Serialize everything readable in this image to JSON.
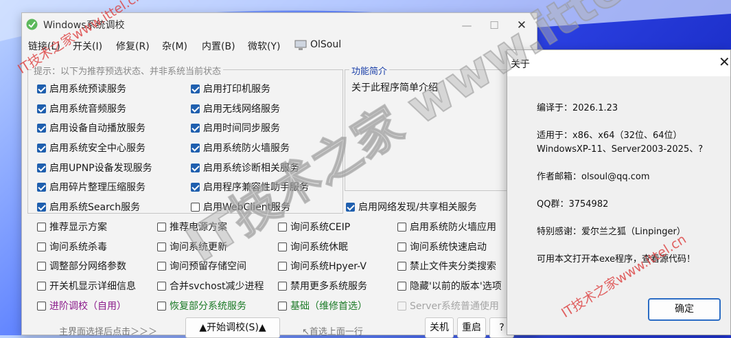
{
  "window": {
    "title": "Windows系统调校"
  },
  "menu": [
    "链接(L)",
    "开关(I)",
    "修复(R)",
    "杂(M)",
    "内置(B)",
    "微软(Y)",
    "OlSoul"
  ],
  "tips_group_label": "提示：以下为推荐预选状态、并非系统当前状态",
  "intro_group": {
    "label": "功能简介",
    "text": "关于此程序简单介绍"
  },
  "checkboxes": {
    "col1": [
      {
        "label": "启用系统预读服务",
        "checked": true
      },
      {
        "label": "启用系统音频服务",
        "checked": true
      },
      {
        "label": "启用设备自动播放服务",
        "checked": true
      },
      {
        "label": "启用系统安全中心服务",
        "checked": true
      },
      {
        "label": "启用UPNP设备发现服务",
        "checked": true
      },
      {
        "label": "启用碎片整理压缩服务",
        "checked": true
      },
      {
        "label": "启用系统Search服务",
        "checked": true
      }
    ],
    "col2": [
      {
        "label": "启用打印机服务",
        "checked": true
      },
      {
        "label": "启用无线网络服务",
        "checked": true
      },
      {
        "label": "启用时间同步服务",
        "checked": true
      },
      {
        "label": "启用系统防火墙服务",
        "checked": true
      },
      {
        "label": "启用系统诊断相关服务",
        "checked": true
      },
      {
        "label": "启用程序兼容性助手服务",
        "checked": true
      },
      {
        "label": "启用WebClient服务",
        "checked": false
      }
    ],
    "network": {
      "label": "启用网络发现/共享相关服务",
      "checked": true
    },
    "grid": [
      [
        "推荐显示方案",
        "推荐电源方案",
        "询问系统CEIP",
        "启用系统防火墙应用"
      ],
      [
        "询问系统杀毒",
        "询问系统更新",
        "询问系统休眠",
        "询问系统快速启动"
      ],
      [
        "调整部分网络参数",
        "询问预留存储空间",
        "询问系统Hpyer-V",
        "禁止文件夹分类搜索"
      ],
      [
        "开关机显示详细信息",
        "合并svchost减少进程",
        "禁用更多系统服务",
        "隐藏'以前的版本'选项"
      ]
    ],
    "last_row": [
      "进阶调校（自用）",
      "恢复部分系统服务",
      "基础（维修首选）",
      "Server系统普通使用"
    ]
  },
  "bottom": {
    "hint_left": "主界面选择后点击＞＞＞",
    "start_button": "▲开始调校(S)▲",
    "hint_right": "↖首选上面一行",
    "shutdown": "关机",
    "restart": "重启",
    "help": "?"
  },
  "about": {
    "title": "关于",
    "lines": [
      "编译于：2026.1.23",
      "适用于：x86、x64（32位、64位）",
      "WindowsXP-11、Server2003-2025、?",
      "作者邮箱：olsoul@qq.com",
      "QQ群：3754982",
      "特别感谢：爱尔兰之狐（Linpinger）",
      "可用本文打开本exe程序，查看源代码！"
    ],
    "ok": "确定"
  },
  "watermark": {
    "small": "IT技术之家www.ittel.cn",
    "big": "IT技术之家 www.ittel.cn"
  },
  "colors": {
    "accent": "#1f5fae",
    "link_blue": "#1a3fa8",
    "purple": "#8b1a8b",
    "green": "#1b7a26"
  }
}
